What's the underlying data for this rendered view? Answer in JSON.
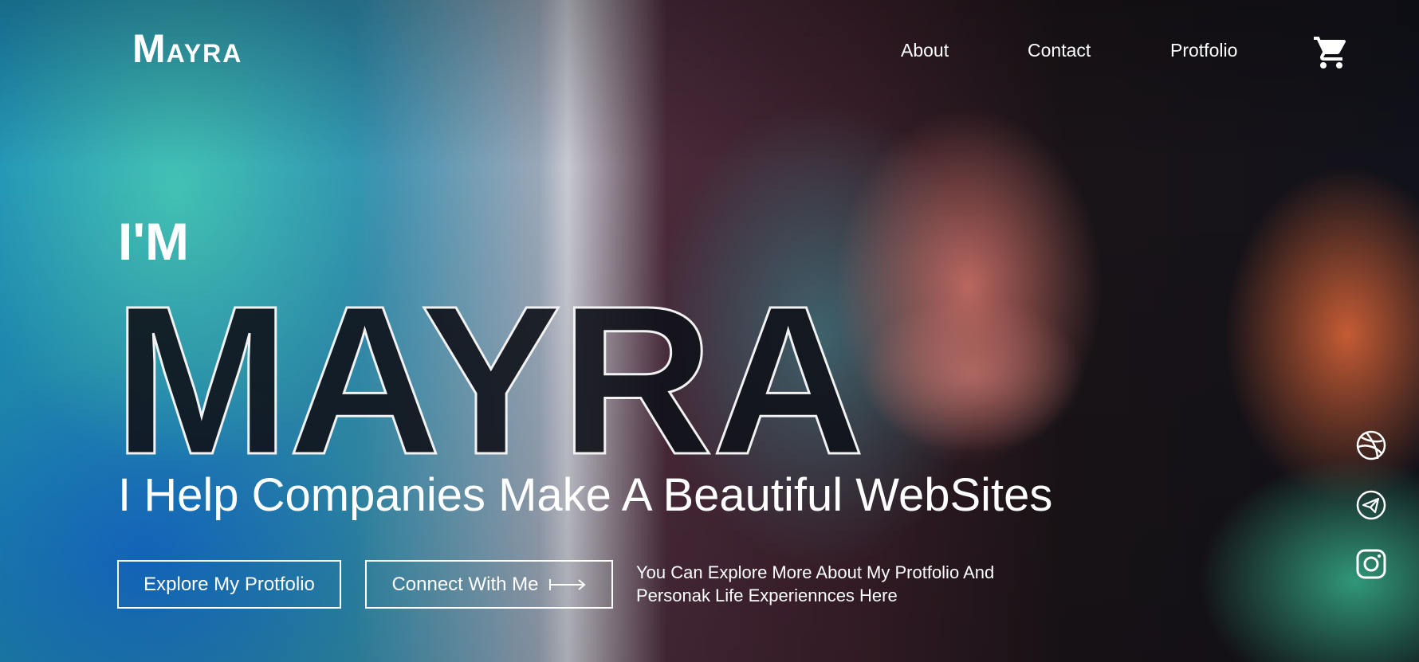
{
  "brand": {
    "logo_initial": "M",
    "logo_rest": "AYRA"
  },
  "nav": {
    "items": [
      "About",
      "Contact",
      "Protfolio"
    ],
    "cart_icon": "cart-icon"
  },
  "hero": {
    "intro": "I'M",
    "name": "MAYRA",
    "tagline": "I Help Companies Make A Beautiful WebSites",
    "primary_button": "Explore My Protfolio",
    "secondary_button": "Connect With Me",
    "note_line1": "You Can Explore More About My Protfolio And",
    "note_line2": "Personak Life Experiennces Here"
  },
  "social": [
    "dribbble-icon",
    "telegram-icon",
    "instagram-icon"
  ]
}
